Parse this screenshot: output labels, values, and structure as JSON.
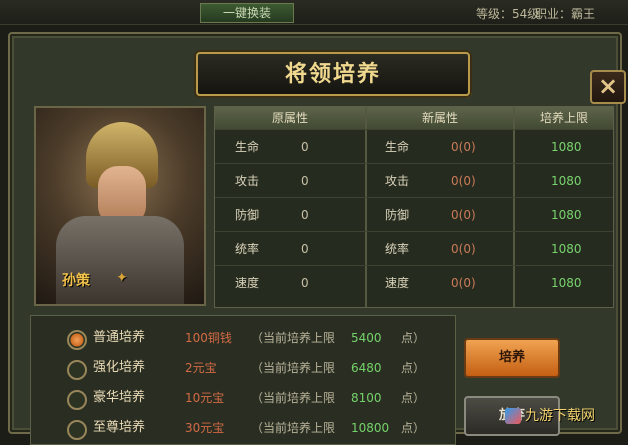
{
  "topbar": {
    "button_label": "一键换装",
    "level_text": "等级：54级",
    "job_text": "职业：霸王"
  },
  "dialog": {
    "title": "将领培养",
    "close_label": "×"
  },
  "hero": {
    "name": "孙策"
  },
  "table": {
    "headers": [
      "原属性",
      "新属性",
      "培养上限"
    ],
    "rows": [
      {
        "attr": "生命",
        "orig": "0",
        "new_attr": "生命",
        "new_val": "0(0)",
        "limit": "1080"
      },
      {
        "attr": "攻击",
        "orig": "0",
        "new_attr": "攻击",
        "new_val": "0(0)",
        "limit": "1080"
      },
      {
        "attr": "防御",
        "orig": "0",
        "new_attr": "防御",
        "new_val": "0(0)",
        "limit": "1080"
      },
      {
        "attr": "统率",
        "orig": "0",
        "new_attr": "统率",
        "new_val": "0(0)",
        "limit": "1080"
      },
      {
        "attr": "速度",
        "orig": "0",
        "new_attr": "速度",
        "new_val": "0(0)",
        "limit": "1080"
      }
    ]
  },
  "options": [
    {
      "name": "普通培养",
      "cost": "100铜钱",
      "text": "（当前培养上限",
      "limit": "5400",
      "unit": "点）",
      "selected": true
    },
    {
      "name": "强化培养",
      "cost": "2元宝",
      "text": "（当前培养上限",
      "limit": "6480",
      "unit": "点）",
      "selected": false
    },
    {
      "name": "豪华培养",
      "cost": "10元宝",
      "text": "（当前培养上限",
      "limit": "8100",
      "unit": "点）",
      "selected": false
    },
    {
      "name": "至尊培养",
      "cost": "30元宝",
      "text": "（当前培养上限",
      "limit": "10800",
      "unit": "点）",
      "selected": false
    }
  ],
  "buttons": {
    "train": "培养",
    "discard": "放弃"
  },
  "watermark": "九游下载网"
}
